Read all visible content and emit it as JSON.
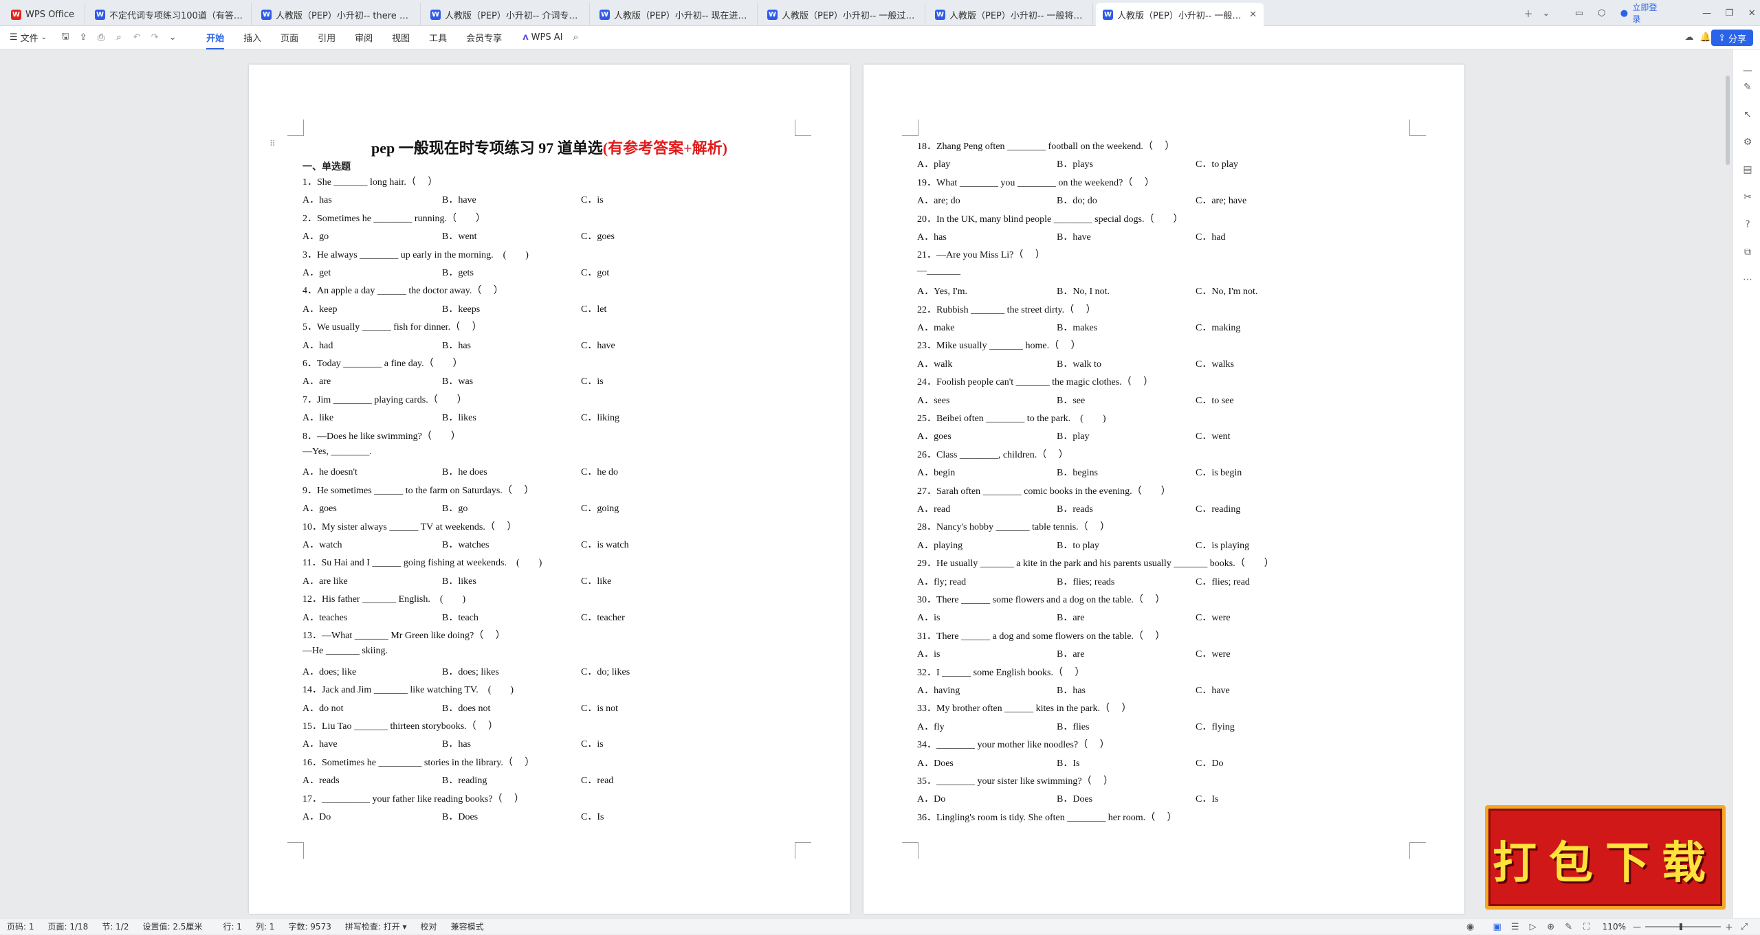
{
  "tabs": [
    {
      "label": "WPS Office",
      "type": "wps"
    },
    {
      "label": "不定代词专项练习100道（有答案和解…",
      "type": "doc"
    },
    {
      "label": "人教版（PEP）小升初-- there be句…",
      "type": "doc"
    },
    {
      "label": "人教版（PEP）小升初-- 介词专项练习…",
      "type": "doc"
    },
    {
      "label": "人教版（PEP）小升初-- 现在进行时专…",
      "type": "doc"
    },
    {
      "label": "人教版（PEP）小升初-- 一般过去时专…",
      "type": "doc"
    },
    {
      "label": "人教版（PEP）小升初-- 一般将来时专…",
      "type": "doc"
    },
    {
      "label": "人教版（PEP）小升初-- 一般…",
      "type": "doc"
    }
  ],
  "tab_right": {
    "login": "立即登录"
  },
  "ribbon": {
    "file": "文件",
    "menus": [
      "开始",
      "插入",
      "页面",
      "引用",
      "审阅",
      "视图",
      "工具",
      "会员专享"
    ],
    "active": "开始",
    "ai": "WPS AI",
    "share": "分享"
  },
  "doc": {
    "title_main": "pep 一般现在时专项练习 97 道单选",
    "title_red": "(有参考答案+解析)",
    "section": "一、单选题",
    "left_items": [
      {
        "q": "1．She _______ long hair.（　 ）",
        "opts": [
          "A．has",
          "B．have",
          "C．is"
        ]
      },
      {
        "q": "2．Sometimes he ________ running.（　　）",
        "opts": [
          "A．go",
          "B．went",
          "C．goes"
        ]
      },
      {
        "q": "3．He always ________ up early in the morning.　(　　)",
        "opts": [
          "A．get",
          "B．gets",
          "C．got"
        ]
      },
      {
        "q": "4．An apple a day ______ the doctor away.（　 ）",
        "opts": [
          "A．keep",
          "B．keeps",
          "C．let"
        ]
      },
      {
        "q": "5．We usually ______ fish for dinner.（　 ）",
        "opts": [
          "A．had",
          "B．has",
          "C．have"
        ]
      },
      {
        "q": "6．Today ________ a fine day.（　　）",
        "opts": [
          "A．are",
          "B．was",
          "C．is"
        ]
      },
      {
        "q": "7．Jim ________ playing cards.（　　）",
        "opts": [
          "A．like",
          "B．likes",
          "C．liking"
        ]
      },
      {
        "q": "8．—Does he like swimming?（　　）",
        "q2": "—Yes, ________.",
        "opts": [
          "A．he doesn't",
          "B．he does",
          "C．he do"
        ]
      },
      {
        "q": "9．He sometimes ______ to the farm on Saturdays.（　 ）",
        "opts": [
          "A．goes",
          "B．go",
          "C．going"
        ]
      },
      {
        "q": "10．My sister always ______ TV at weekends.（　 ）",
        "opts": [
          "A．watch",
          "B．watches",
          "C．is watch"
        ]
      },
      {
        "q": "11．Su Hai and I ______ going fishing at weekends.　(　　)",
        "opts": [
          "A．are like",
          "B．likes",
          "C．like"
        ]
      },
      {
        "q": "12．His father _______ English.　(　　)",
        "opts": [
          "A．teaches",
          "B．teach",
          "C．teacher"
        ]
      },
      {
        "q": "13．—What _______ Mr Green like doing?（　 ）",
        "q2": "—He _______ skiing.",
        "opts": [
          "A．does; like",
          "B．does; likes",
          "C．do; likes"
        ]
      },
      {
        "q": "14．Jack and Jim _______ like watching TV.　(　　)",
        "opts": [
          "A．do not",
          "B．does not",
          "C．is not"
        ]
      },
      {
        "q": "15．Liu Tao _______ thirteen storybooks.（　 ）",
        "opts": [
          "A．have",
          "B．has",
          "C．is"
        ]
      },
      {
        "q": "16．Sometimes he _________ stories in the library.（　 ）",
        "opts": [
          "A．reads",
          "B．reading",
          "C．read"
        ]
      },
      {
        "q": "17．__________ your father like reading books?（　 ）",
        "opts": [
          "A．Do",
          "B．Does",
          "C．Is"
        ]
      }
    ],
    "right_items": [
      {
        "q": "18．Zhang Peng often ________ football on the weekend.（　 ）",
        "opts": [
          "A．play",
          "B．plays",
          "C．to play"
        ]
      },
      {
        "q": "19．What ________ you ________ on the weekend?（　 ）",
        "opts": [
          "A．are; do",
          "B．do; do",
          "C．are; have"
        ]
      },
      {
        "q": "20．In the UK, many blind people ________ special dogs.（　　）",
        "opts": [
          "A．has",
          "B．have",
          "C．had"
        ]
      },
      {
        "q": "21．—Are you Miss Li?（　 ）",
        "q2": "—_______",
        "opts": [
          "A．Yes, I'm.",
          "B．No, I not.",
          "C．No, I'm not."
        ]
      },
      {
        "q": "22．Rubbish _______ the street dirty.（　 ）",
        "opts": [
          "A．make",
          "B．makes",
          "C．making"
        ]
      },
      {
        "q": "23．Mike usually _______ home.（　 ）",
        "opts": [
          "A．walk",
          "B．walk to",
          "C．walks"
        ]
      },
      {
        "q": "24．Foolish people can't _______ the magic clothes.（　 ）",
        "opts": [
          "A．sees",
          "B．see",
          "C．to see"
        ]
      },
      {
        "q": "25．Beibei often ________ to the park.　(　　)",
        "opts": [
          "A．goes",
          "B．play",
          "C．went"
        ]
      },
      {
        "q": "26．Class ________, children.（　 ）",
        "opts": [
          "A．begin",
          "B．begins",
          "C．is begin"
        ]
      },
      {
        "q": "27．Sarah often ________ comic books in the evening.（　　）",
        "opts": [
          "A．read",
          "B．reads",
          "C．reading"
        ]
      },
      {
        "q": "28．Nancy's hobby _______ table tennis.（　 ）",
        "opts": [
          "A．playing",
          "B．to play",
          "C．is playing"
        ]
      },
      {
        "q": "29．He usually _______ a kite in the park and his parents usually _______ books.（　　）",
        "opts": [
          "A．fly; read",
          "B．flies; reads",
          "C．flies; read"
        ]
      },
      {
        "q": "30．There ______ some flowers and a dog on the table.（　 ）",
        "opts": [
          "A．is",
          "B．are",
          "C．were"
        ]
      },
      {
        "q": "31．There ______ a dog and some flowers on the table.（　 ）",
        "opts": [
          "A．is",
          "B．are",
          "C．were"
        ]
      },
      {
        "q": "32．I ______ some English books.（　 ）",
        "opts": [
          "A．having",
          "B．has",
          "C．have"
        ]
      },
      {
        "q": "33．My brother often ______ kites in the park.（　 ）",
        "opts": [
          "A．fly",
          "B．flies",
          "C．flying"
        ]
      },
      {
        "q": "34．________ your mother like noodles?（　 ）",
        "opts": [
          "A．Does",
          "B．Is",
          "C．Do"
        ]
      },
      {
        "q": "35．________ your sister like swimming?（　 ）",
        "opts": [
          "A．Do",
          "B．Does",
          "C．Is"
        ]
      },
      {
        "q": "36．Lingling's room is tidy. She often ________ her room.（　 ）",
        "opts": []
      }
    ]
  },
  "status": {
    "page_no": "页码: 1",
    "pages": "页面: 1/18",
    "section": "节: 1/2",
    "setting": "设置值: 2.5厘米",
    "row": "行: 1",
    "col": "列: 1",
    "words": "字数: 9573",
    "spell": "拼写检查: 打开 ▾",
    "proof": "校对",
    "compat": "兼容模式",
    "zoom": "110%"
  },
  "stamp": {
    "text": "打包下载"
  },
  "colors": {
    "accent": "#2a63e8",
    "title_red": "#e21b1b",
    "stamp_red": "#d01818",
    "stamp_yellow": "#ffe33b"
  }
}
